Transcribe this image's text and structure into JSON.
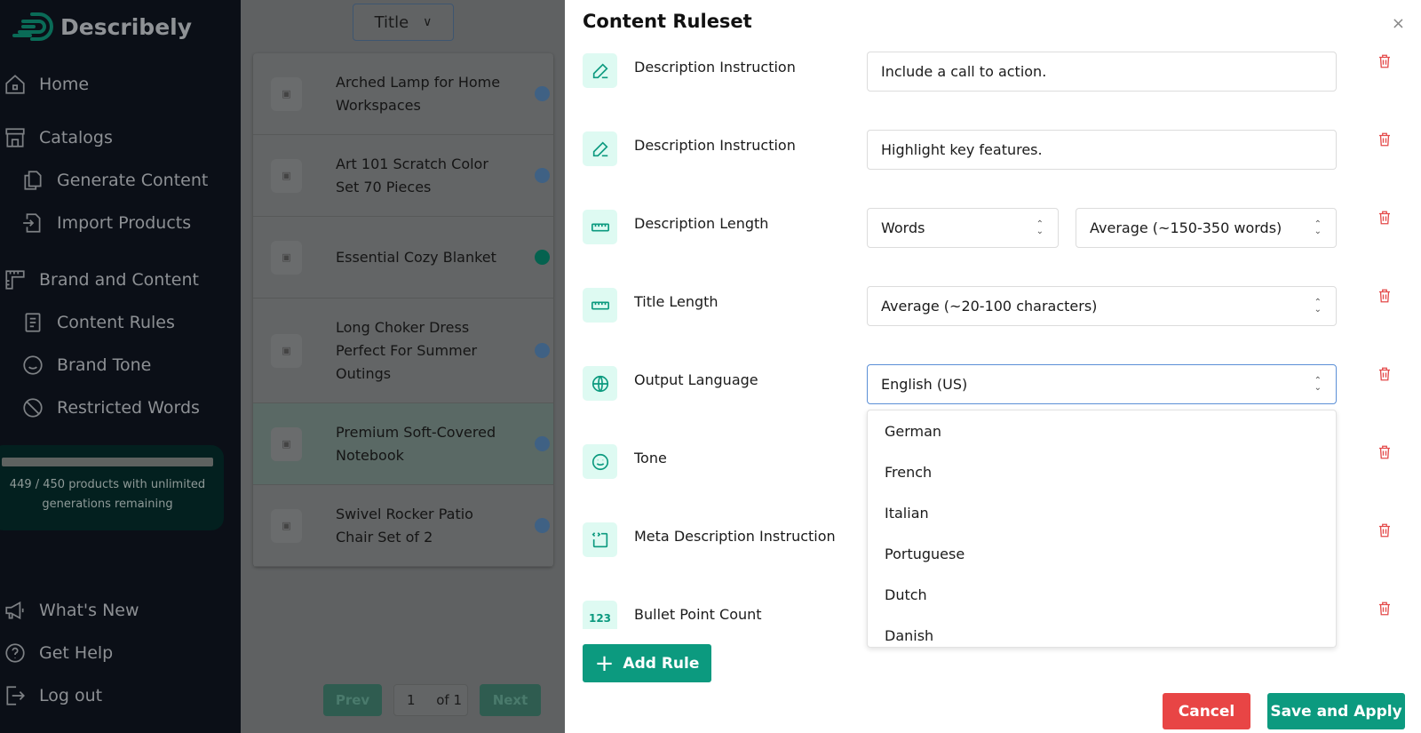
{
  "app": {
    "name": "Describely",
    "brand_color": "#0c9a7f"
  },
  "sidebar": {
    "items": [
      {
        "label": "Home",
        "icon": "home-icon"
      },
      {
        "label": "Catalogs",
        "icon": "store-icon"
      },
      {
        "label": "Generate Content",
        "icon": "copy-icon"
      },
      {
        "label": "Import Products",
        "icon": "import-icon"
      },
      {
        "label": "Brand and Content",
        "icon": "ruler-icon"
      },
      {
        "label": "Content Rules",
        "icon": "document-icon"
      },
      {
        "label": "Brand Tone",
        "icon": "smile-icon"
      },
      {
        "label": "Restricted Words",
        "icon": "ban-icon"
      }
    ],
    "usage": {
      "used": "449 /",
      "total": "450",
      "text": "products with unlimited generations remaining",
      "fraction": 0.998
    },
    "bottom": [
      {
        "label": "What's New",
        "icon": "megaphone-icon"
      },
      {
        "label": "Get Help",
        "icon": "help-icon"
      },
      {
        "label": "Log out",
        "icon": "logout-icon"
      }
    ]
  },
  "products": {
    "sort_label": "Title",
    "items": [
      {
        "name": "Arched Lamp for Home Workspaces",
        "status": "blue"
      },
      {
        "name": "Art 101 Scratch Color Set 70 Pieces",
        "status": "blue"
      },
      {
        "name": "Essential Cozy Blanket",
        "status": "green"
      },
      {
        "name": "Long Choker Dress Perfect For Summer Outings",
        "status": "blue"
      },
      {
        "name": "Premium Soft-Covered Notebook",
        "status": "blue",
        "selected": true
      },
      {
        "name": "Swivel Rocker Patio Chair Set of 2",
        "status": "blue"
      }
    ],
    "pager": {
      "prev": "Prev",
      "page": "1",
      "of": "of 1",
      "next": "Next"
    }
  },
  "ruleset": {
    "title": "Content Ruleset",
    "close": "×",
    "rules": [
      {
        "label": "Description Instruction",
        "icon": "pencil-icon",
        "value": "Include a call to action."
      },
      {
        "label": "Description Instruction",
        "icon": "pencil-icon",
        "value": "Highlight key features."
      },
      {
        "label": "Description Length",
        "icon": "ruler-icon",
        "unit": "Words",
        "value": "Average (~150-350 words)"
      },
      {
        "label": "Title Length",
        "icon": "ruler-icon",
        "value": "Average (~20-100 characters)"
      },
      {
        "label": "Output Language",
        "icon": "globe-icon",
        "value": "English (US)"
      },
      {
        "label": "Tone",
        "icon": "smile-icon"
      },
      {
        "label": "Meta Description Instruction",
        "icon": "code-box-icon"
      },
      {
        "label": "Bullet Point Count",
        "icon": "numbers-icon",
        "icon_text": "123"
      }
    ],
    "language_options": [
      "German",
      "French",
      "Italian",
      "Portuguese",
      "Dutch",
      "Danish"
    ],
    "add_rule": "Add Rule",
    "cancel": "Cancel",
    "save": "Save and Apply",
    "colors": {
      "cancel": "#e84545",
      "save": "#0c9a7f",
      "delete": "#e44b4b"
    }
  }
}
